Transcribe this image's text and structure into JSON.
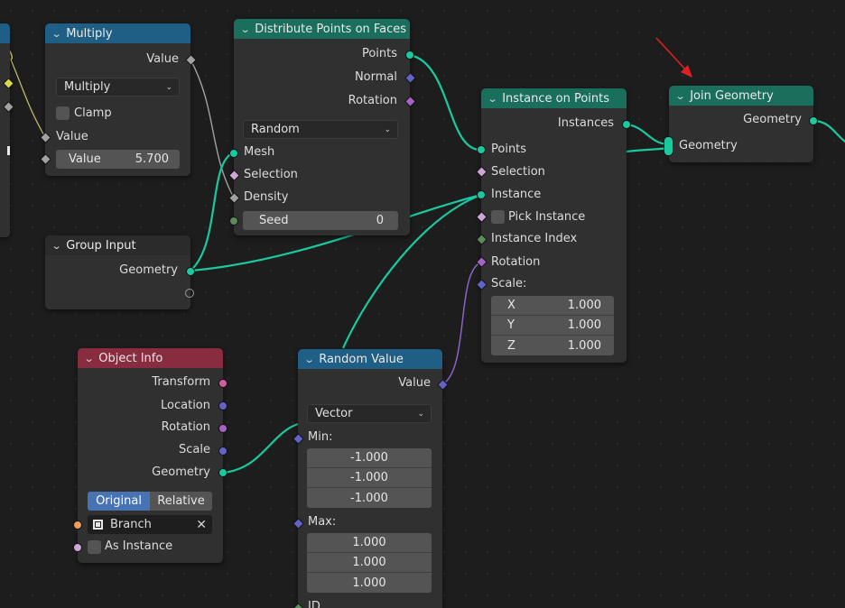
{
  "colors": {
    "canvas_bg": "#1d1d1d",
    "node_bg": "#303030",
    "header_blue": "#1f5f86",
    "header_green": "#1a6e5c",
    "header_red": "#8a2c40",
    "geometry_socket": "#19c9a0",
    "float_socket": "#a1a1a1",
    "vector_socket": "#6363c7",
    "rotation_socket": "#a663c7",
    "int_socket": "#5d8a5d",
    "bool_socket": "#cca6d6",
    "object_socket": "#ed9e5c",
    "matrix_socket": "#cf5fa0",
    "link_yellow": "#d8d84a",
    "arrow_red": "#e02020"
  },
  "nodes": {
    "multiply": {
      "title": "Multiply",
      "out_value": "Value",
      "operation": "Multiply",
      "clamp_label": "Clamp",
      "in_value": "Value",
      "field_label": "Value",
      "field_value": "5.700"
    },
    "distribute": {
      "title": "Distribute Points on Faces",
      "out_points": "Points",
      "out_normal": "Normal",
      "out_rotation": "Rotation",
      "mode": "Random",
      "in_mesh": "Mesh",
      "in_selection": "Selection",
      "in_density": "Density",
      "seed_label": "Seed",
      "seed_value": "0"
    },
    "instance_on_points": {
      "title": "Instance on Points",
      "out_instances": "Instances",
      "in_points": "Points",
      "in_selection": "Selection",
      "in_instance": "Instance",
      "pick_instance": "Pick Instance",
      "instance_index": "Instance Index",
      "rotation": "Rotation",
      "scale_label": "Scale:",
      "scale": [
        {
          "axis": "X",
          "value": "1.000"
        },
        {
          "axis": "Y",
          "value": "1.000"
        },
        {
          "axis": "Z",
          "value": "1.000"
        }
      ]
    },
    "join_geometry": {
      "title": "Join Geometry",
      "out_geometry": "Geometry",
      "in_geometry": "Geometry"
    },
    "group_input": {
      "title": "Group Input",
      "out_geometry": "Geometry"
    },
    "object_info": {
      "title": "Object Info",
      "out_transform": "Transform",
      "out_location": "Location",
      "out_rotation": "Rotation",
      "out_scale": "Scale",
      "out_geometry": "Geometry",
      "mode_original": "Original",
      "mode_relative": "Relative",
      "object_name": "Branch",
      "as_instance": "As Instance"
    },
    "random_value": {
      "title": "Random Value",
      "out_value": "Value",
      "data_type": "Vector",
      "min_label": "Min:",
      "min": [
        "-1.000",
        "-1.000",
        "-1.000"
      ],
      "max_label": "Max:",
      "max": [
        "1.000",
        "1.000",
        "1.000"
      ],
      "id_label": "ID"
    }
  },
  "icons": {
    "collapse": "chevron-down-icon",
    "dropdown": "chevron-down-icon",
    "clear": "close-icon",
    "object": "object-icon",
    "annotation": "red-arrow"
  }
}
